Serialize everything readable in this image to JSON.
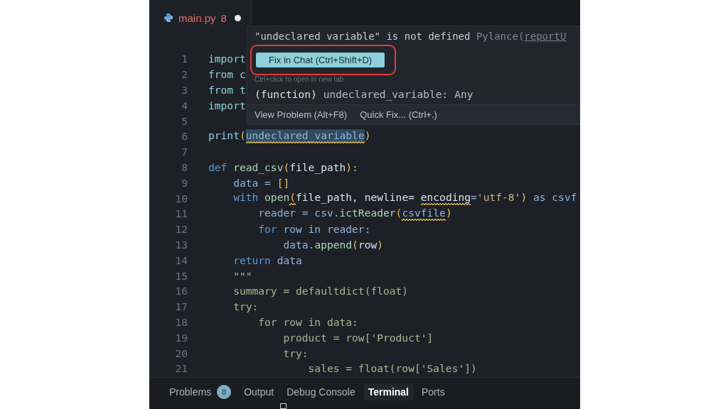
{
  "tab": {
    "filename": "main.py",
    "problem_count": "8",
    "modified": true
  },
  "lines": [
    {
      "number": "1",
      "tokens": [
        {
          "text": "import",
          "kind": "kw2"
        }
      ]
    },
    {
      "number": "2",
      "tokens": [
        {
          "text": "from c",
          "kind": "kw2"
        }
      ]
    },
    {
      "number": "3",
      "tokens": [
        {
          "text": "from t",
          "kind": "kw2"
        }
      ]
    },
    {
      "number": "4",
      "tokens": [
        {
          "text": "import",
          "kind": "kw2"
        }
      ]
    },
    {
      "number": "5"
    },
    {
      "number": "6",
      "tokens": [
        {
          "text": "print",
          "kind": "kw2"
        },
        {
          "text": "(",
          "kind": "paren"
        },
        {
          "text": "undeclared_variable",
          "kind": "var",
          "squiggle": true,
          "selected": true
        },
        {
          "text": ")",
          "kind": "paren"
        }
      ]
    },
    {
      "number": "7"
    },
    {
      "number": "8",
      "tokens": [
        {
          "text": "def ",
          "kind": "kw"
        },
        {
          "text": "read_csv",
          "kind": "fn"
        },
        {
          "text": "(",
          "kind": "paren"
        },
        {
          "text": "file_path",
          "kind": "param"
        },
        {
          "text": "):",
          "kind": "paren"
        }
      ]
    },
    {
      "number": "9",
      "tokens": [
        {
          "text": "    data = ",
          "kind": "var"
        },
        {
          "text": "[]",
          "kind": "paren"
        }
      ]
    },
    {
      "number": "10",
      "tokens": [
        {
          "text": "    with ",
          "kind": "kw"
        },
        {
          "text": "open",
          "kind": "fn"
        },
        {
          "text": "(",
          "kind": "paren",
          "squiggle": true
        },
        {
          "text": "file_path, newline= ",
          "kind": "param"
        },
        {
          "text": "encoding",
          "kind": "param",
          "squiggle": true
        },
        {
          "text": "=",
          "kind": "var"
        },
        {
          "text": "'utf-8'",
          "kind": "str"
        },
        {
          "text": ") ",
          "kind": "paren"
        },
        {
          "text": "as csvf",
          "kind": "var"
        }
      ]
    },
    {
      "number": "11",
      "tokens": [
        {
          "text": "        reader = csv.",
          "kind": "var"
        },
        {
          "text": "ictReader",
          "kind": "fn"
        },
        {
          "text": "(",
          "kind": "paren"
        },
        {
          "text": "csvfile",
          "kind": "var",
          "squiggle": true
        },
        {
          "text": ")",
          "kind": "paren"
        }
      ]
    },
    {
      "number": "12",
      "tokens": [
        {
          "text": "        for ",
          "kind": "kw"
        },
        {
          "text": "row in reader:",
          "kind": "var"
        }
      ]
    },
    {
      "number": "13",
      "tokens": [
        {
          "text": "            data.",
          "kind": "var"
        },
        {
          "text": "append",
          "kind": "fn"
        },
        {
          "text": "(",
          "kind": "paren"
        },
        {
          "text": "row",
          "kind": "param"
        },
        {
          "text": ")",
          "kind": "paren"
        }
      ]
    },
    {
      "number": "14",
      "tokens": [
        {
          "text": "    return ",
          "kind": "kw"
        },
        {
          "text": "data",
          "kind": "var"
        }
      ]
    },
    {
      "number": "15",
      "tokens": [
        {
          "text": "    \"\"\"",
          "kind": "doc"
        }
      ]
    },
    {
      "number": "16",
      "tokens": [
        {
          "text": "    summary = defaultdict(float)",
          "kind": "doc"
        }
      ]
    },
    {
      "number": "17",
      "tokens": [
        {
          "text": "    try:",
          "kind": "doc"
        }
      ]
    },
    {
      "number": "18",
      "tokens": [
        {
          "text": "        for row in data:",
          "kind": "doc"
        }
      ]
    },
    {
      "number": "19",
      "tokens": [
        {
          "text": "            product = row['Product']",
          "kind": "doc"
        }
      ]
    },
    {
      "number": "20",
      "tokens": [
        {
          "text": "            try:",
          "kind": "doc"
        }
      ]
    },
    {
      "number": "21",
      "tokens": [
        {
          "text": "                sales = float(row['Sales'])",
          "kind": "doc"
        }
      ]
    }
  ],
  "hover": {
    "message": "\"undeclared variable\" is not defined",
    "source": "Pylance(",
    "rule": "reportU",
    "fix_button": "Fix in Chat (Ctrl+Shift+D)",
    "hint": "Ctrl+click to open in new tab",
    "signature_keyword": "(function)",
    "signature": " undeclared_variable: Any",
    "actions": [
      "View Problem (Alt+F8)",
      "Quick Fix... (Ctrl+.)"
    ]
  },
  "panel_tabs": [
    {
      "label": "Problems",
      "badge": "8",
      "selected": false
    },
    {
      "label": "Output",
      "selected": false
    },
    {
      "label": "Debug Console",
      "selected": false
    },
    {
      "label": "Terminal",
      "selected": true
    },
    {
      "label": "Ports",
      "selected": false
    }
  ]
}
